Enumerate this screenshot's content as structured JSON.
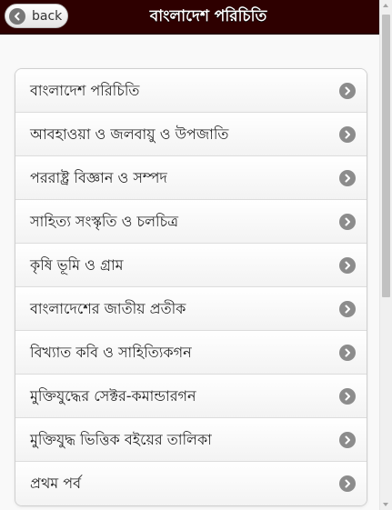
{
  "header": {
    "back_label": "back",
    "title": "বাংলাদেশ পরিচিতি"
  },
  "menu": {
    "items": [
      {
        "label": "বাংলাদেশ পরিচিতি"
      },
      {
        "label": "আবহাওয়া ও জলবায়ু ও উপজাতি"
      },
      {
        "label": "পররাষ্ট্র বিজ্ঞান ও সম্পদ"
      },
      {
        "label": "সাহিত্য সংস্কৃতি ও চলচিত্র"
      },
      {
        "label": "কৃষি ভূমি ও গ্রাম"
      },
      {
        "label": "বাংলাদেশের জাতীয় প্রতীক"
      },
      {
        "label": "বিখ্যাত কবি ও সাহিত্যিকগন"
      },
      {
        "label": "মুক্তিযুদ্ধের সেক্টর-কমান্ডারগন"
      },
      {
        "label": "মুক্তিযুদ্ধ ভিত্তিক বইয়ের তালিকা"
      },
      {
        "label": "প্রথম পর্ব"
      }
    ]
  },
  "icons": {
    "back": "arrow-left-circle-icon",
    "item_arrow": "chevron-right-circle-icon"
  },
  "colors": {
    "header_bg": "#2e0000",
    "item_arrow": "#8c8c8c"
  }
}
